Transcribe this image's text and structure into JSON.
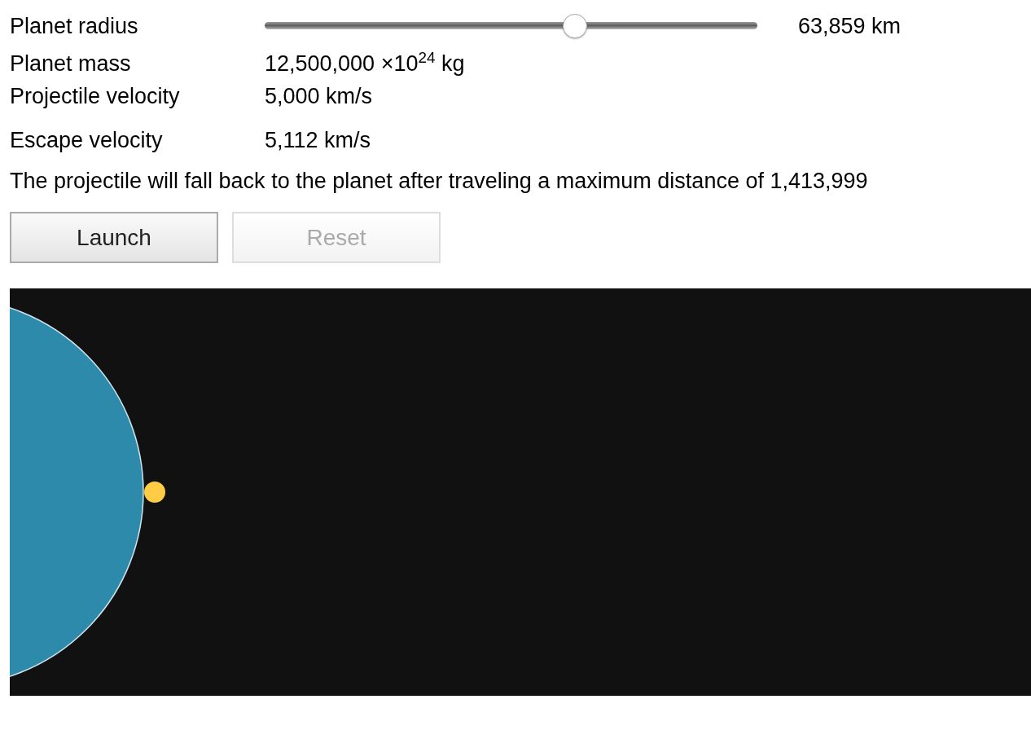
{
  "parameters": [
    {
      "kind": "slider",
      "label": "Planet radius",
      "level": 0.63,
      "value": "63,859 km"
    },
    {
      "kind": "readout",
      "label": "Planet mass",
      "value": "12,500,000 ×10$^{24}$ kg"
    },
    {
      "kind": "readout",
      "label": "Projectile velocity",
      "value": "5,000 km/s"
    },
    {
      "kind": "readout",
      "label": "Escape velocity",
      "value": "5,112 km/s"
    }
  ],
  "message": "The projectile will fall back to the planet after traveling a maximum distance of 1,413,999",
  "buttons": [
    {
      "label": "Launch",
      "disabled": false
    },
    {
      "label": "Reset",
      "disabled": true
    }
  ]
}
